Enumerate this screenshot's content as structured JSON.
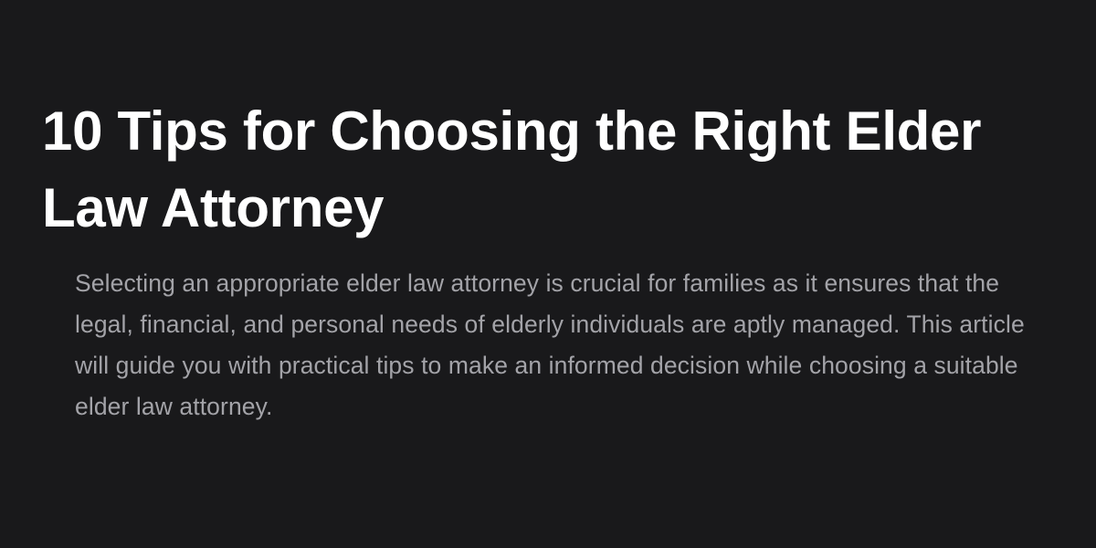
{
  "article": {
    "title": "10 Tips for Choosing the Right Elder Law Attorney",
    "excerpt": "Selecting an appropriate elder law attorney is crucial for families as it ensures that the legal, financial, and personal needs of elderly individuals are aptly managed. This article will guide you with practical tips to make an informed decision while choosing a suitable elder law attorney."
  },
  "colors": {
    "background": "#19191b",
    "title": "#ffffff",
    "excerpt": "#a3a3a8"
  }
}
